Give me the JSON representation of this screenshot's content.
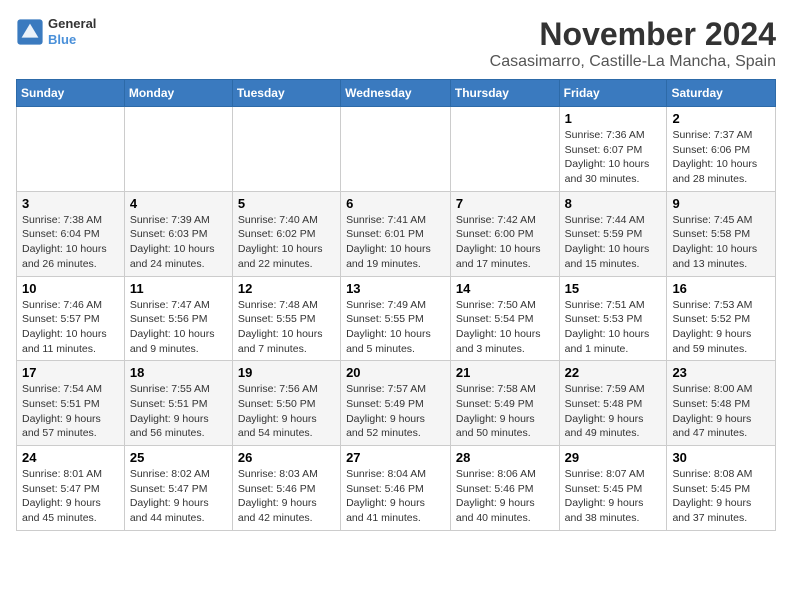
{
  "logo": {
    "line1": "General",
    "line2": "Blue"
  },
  "header": {
    "month": "November 2024",
    "location": "Casasimarro, Castille-La Mancha, Spain"
  },
  "weekdays": [
    "Sunday",
    "Monday",
    "Tuesday",
    "Wednesday",
    "Thursday",
    "Friday",
    "Saturday"
  ],
  "weeks": [
    [
      {
        "day": "",
        "info": ""
      },
      {
        "day": "",
        "info": ""
      },
      {
        "day": "",
        "info": ""
      },
      {
        "day": "",
        "info": ""
      },
      {
        "day": "",
        "info": ""
      },
      {
        "day": "1",
        "info": "Sunrise: 7:36 AM\nSunset: 6:07 PM\nDaylight: 10 hours and 30 minutes."
      },
      {
        "day": "2",
        "info": "Sunrise: 7:37 AM\nSunset: 6:06 PM\nDaylight: 10 hours and 28 minutes."
      }
    ],
    [
      {
        "day": "3",
        "info": "Sunrise: 7:38 AM\nSunset: 6:04 PM\nDaylight: 10 hours and 26 minutes."
      },
      {
        "day": "4",
        "info": "Sunrise: 7:39 AM\nSunset: 6:03 PM\nDaylight: 10 hours and 24 minutes."
      },
      {
        "day": "5",
        "info": "Sunrise: 7:40 AM\nSunset: 6:02 PM\nDaylight: 10 hours and 22 minutes."
      },
      {
        "day": "6",
        "info": "Sunrise: 7:41 AM\nSunset: 6:01 PM\nDaylight: 10 hours and 19 minutes."
      },
      {
        "day": "7",
        "info": "Sunrise: 7:42 AM\nSunset: 6:00 PM\nDaylight: 10 hours and 17 minutes."
      },
      {
        "day": "8",
        "info": "Sunrise: 7:44 AM\nSunset: 5:59 PM\nDaylight: 10 hours and 15 minutes."
      },
      {
        "day": "9",
        "info": "Sunrise: 7:45 AM\nSunset: 5:58 PM\nDaylight: 10 hours and 13 minutes."
      }
    ],
    [
      {
        "day": "10",
        "info": "Sunrise: 7:46 AM\nSunset: 5:57 PM\nDaylight: 10 hours and 11 minutes."
      },
      {
        "day": "11",
        "info": "Sunrise: 7:47 AM\nSunset: 5:56 PM\nDaylight: 10 hours and 9 minutes."
      },
      {
        "day": "12",
        "info": "Sunrise: 7:48 AM\nSunset: 5:55 PM\nDaylight: 10 hours and 7 minutes."
      },
      {
        "day": "13",
        "info": "Sunrise: 7:49 AM\nSunset: 5:55 PM\nDaylight: 10 hours and 5 minutes."
      },
      {
        "day": "14",
        "info": "Sunrise: 7:50 AM\nSunset: 5:54 PM\nDaylight: 10 hours and 3 minutes."
      },
      {
        "day": "15",
        "info": "Sunrise: 7:51 AM\nSunset: 5:53 PM\nDaylight: 10 hours and 1 minute."
      },
      {
        "day": "16",
        "info": "Sunrise: 7:53 AM\nSunset: 5:52 PM\nDaylight: 9 hours and 59 minutes."
      }
    ],
    [
      {
        "day": "17",
        "info": "Sunrise: 7:54 AM\nSunset: 5:51 PM\nDaylight: 9 hours and 57 minutes."
      },
      {
        "day": "18",
        "info": "Sunrise: 7:55 AM\nSunset: 5:51 PM\nDaylight: 9 hours and 56 minutes."
      },
      {
        "day": "19",
        "info": "Sunrise: 7:56 AM\nSunset: 5:50 PM\nDaylight: 9 hours and 54 minutes."
      },
      {
        "day": "20",
        "info": "Sunrise: 7:57 AM\nSunset: 5:49 PM\nDaylight: 9 hours and 52 minutes."
      },
      {
        "day": "21",
        "info": "Sunrise: 7:58 AM\nSunset: 5:49 PM\nDaylight: 9 hours and 50 minutes."
      },
      {
        "day": "22",
        "info": "Sunrise: 7:59 AM\nSunset: 5:48 PM\nDaylight: 9 hours and 49 minutes."
      },
      {
        "day": "23",
        "info": "Sunrise: 8:00 AM\nSunset: 5:48 PM\nDaylight: 9 hours and 47 minutes."
      }
    ],
    [
      {
        "day": "24",
        "info": "Sunrise: 8:01 AM\nSunset: 5:47 PM\nDaylight: 9 hours and 45 minutes."
      },
      {
        "day": "25",
        "info": "Sunrise: 8:02 AM\nSunset: 5:47 PM\nDaylight: 9 hours and 44 minutes."
      },
      {
        "day": "26",
        "info": "Sunrise: 8:03 AM\nSunset: 5:46 PM\nDaylight: 9 hours and 42 minutes."
      },
      {
        "day": "27",
        "info": "Sunrise: 8:04 AM\nSunset: 5:46 PM\nDaylight: 9 hours and 41 minutes."
      },
      {
        "day": "28",
        "info": "Sunrise: 8:06 AM\nSunset: 5:46 PM\nDaylight: 9 hours and 40 minutes."
      },
      {
        "day": "29",
        "info": "Sunrise: 8:07 AM\nSunset: 5:45 PM\nDaylight: 9 hours and 38 minutes."
      },
      {
        "day": "30",
        "info": "Sunrise: 8:08 AM\nSunset: 5:45 PM\nDaylight: 9 hours and 37 minutes."
      }
    ]
  ]
}
